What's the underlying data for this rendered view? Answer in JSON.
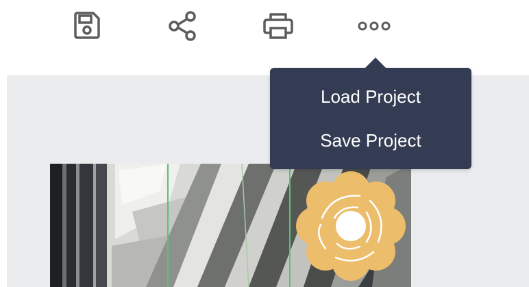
{
  "toolbar": {
    "buttons": [
      {
        "name": "save",
        "icon": "floppy-disk-icon"
      },
      {
        "name": "share",
        "icon": "share-icon"
      },
      {
        "name": "print",
        "icon": "printer-icon"
      },
      {
        "name": "more",
        "icon": "more-dots-icon"
      }
    ],
    "icon_color": "#5c5c5c"
  },
  "menu": {
    "items": [
      {
        "label": "Load Project"
      },
      {
        "label": "Save Project"
      }
    ],
    "background": "#333c52",
    "text_color": "#ffffff"
  },
  "canvas": {
    "background": "#ebeced",
    "sticker_color": "#ecbd6a"
  }
}
